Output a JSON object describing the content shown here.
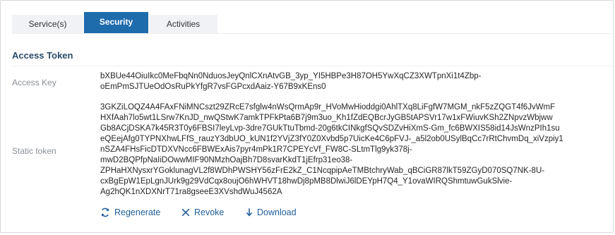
{
  "tabs": {
    "services": "Service(s)",
    "security": "Security",
    "activities": "Activities"
  },
  "section": {
    "title": "Access Token"
  },
  "access_key": {
    "label": "Access Key",
    "lines": [
      "bXBUe44OiuIkc0MeFbqNn0NduosJeyQnlCXnAtvGB_3yp_YI5HBPe3H87OH5YwXqCZ3XWTpnXi1t4Zbp-",
      "oEmPmSJTUeOdOsRuPkYfgR7vsFGPcxdAaiz-Y67B9xKEns0"
    ]
  },
  "static_token": {
    "label": "Static token",
    "lines": [
      "3GKZiLOQZ4A4FAxFNiMNCszt29ZRcE7sfglw4nWsQrmAp9r_HVoMwHioddgi0AhlTXq8LiFgfW7MGM_nkF5zZQGT4f6JvWmF",
      "HXfAah7lo5wt1LSrw7KnJD_nwQStwK7amkTPFkPta6B7j9m3uo_Kh1fZdEQBcrJyGB5tAPSVr17w1xFWiuvKSh2ZNpvzWbjww",
      "Gb8ACjDSKA7k45R3T0y6FBSI7leyLvp-3dre7GUkTtuTbmd-20g6tkCINkgfSQvSDZvHiXmS-Gm_fc6BWXIS58id14JsWnzPIh1su",
      "eQEejAfg0TYPNXhwLFfS_rauzY3dbUO_kUN1f2YVjZ3fY0Z0Xvbd5p7UicKe4C6pFVJ-_a5l2ob0USylBqCc7rRtChvmDq_xiVzpiy1",
      "nSZA4FHsFicDTDXVNcc6FBWExAis7pyr4mPk1R7CPEYcVf_FW8C-SLtmTlg9yk378j-",
      "mwD2BQPfpNaIiDOwwMIF90NMzhOajBh7D8svarKkdT1jEfrp31eo38-",
      "ZPHaHXNysxrYGoklunagVL2f8WDhPWSHY56zFrE2kZ_C1NcqpipAeTMBtchryWab_qBCiGR87lkT59ZGyD070SQ7NK-8U-",
      "cxBgEpW1EpLgnJUrk9g29VdCqx8oujO6hWHVT18hwDj8pMB8DlwiJ6lDEYpH7Q4_Y1ovaWIRQShmtuwGukSlvie-",
      "Ag2hQK1nXDXNrT71ra8gseeE3XVshdWuJ4562A"
    ]
  },
  "actions": {
    "regenerate": "Regenerate",
    "revoke": "Revoke",
    "download": "Download"
  },
  "colors": {
    "tab_active_bg": "#1f6cad",
    "tab_inactive_bg": "#f0f2f5",
    "link": "#1f5e9b",
    "section_title": "#2b4b68",
    "label": "#8a8f96"
  },
  "icons": {
    "regenerate": "refresh-icon",
    "revoke": "close-icon",
    "download": "download-icon"
  }
}
